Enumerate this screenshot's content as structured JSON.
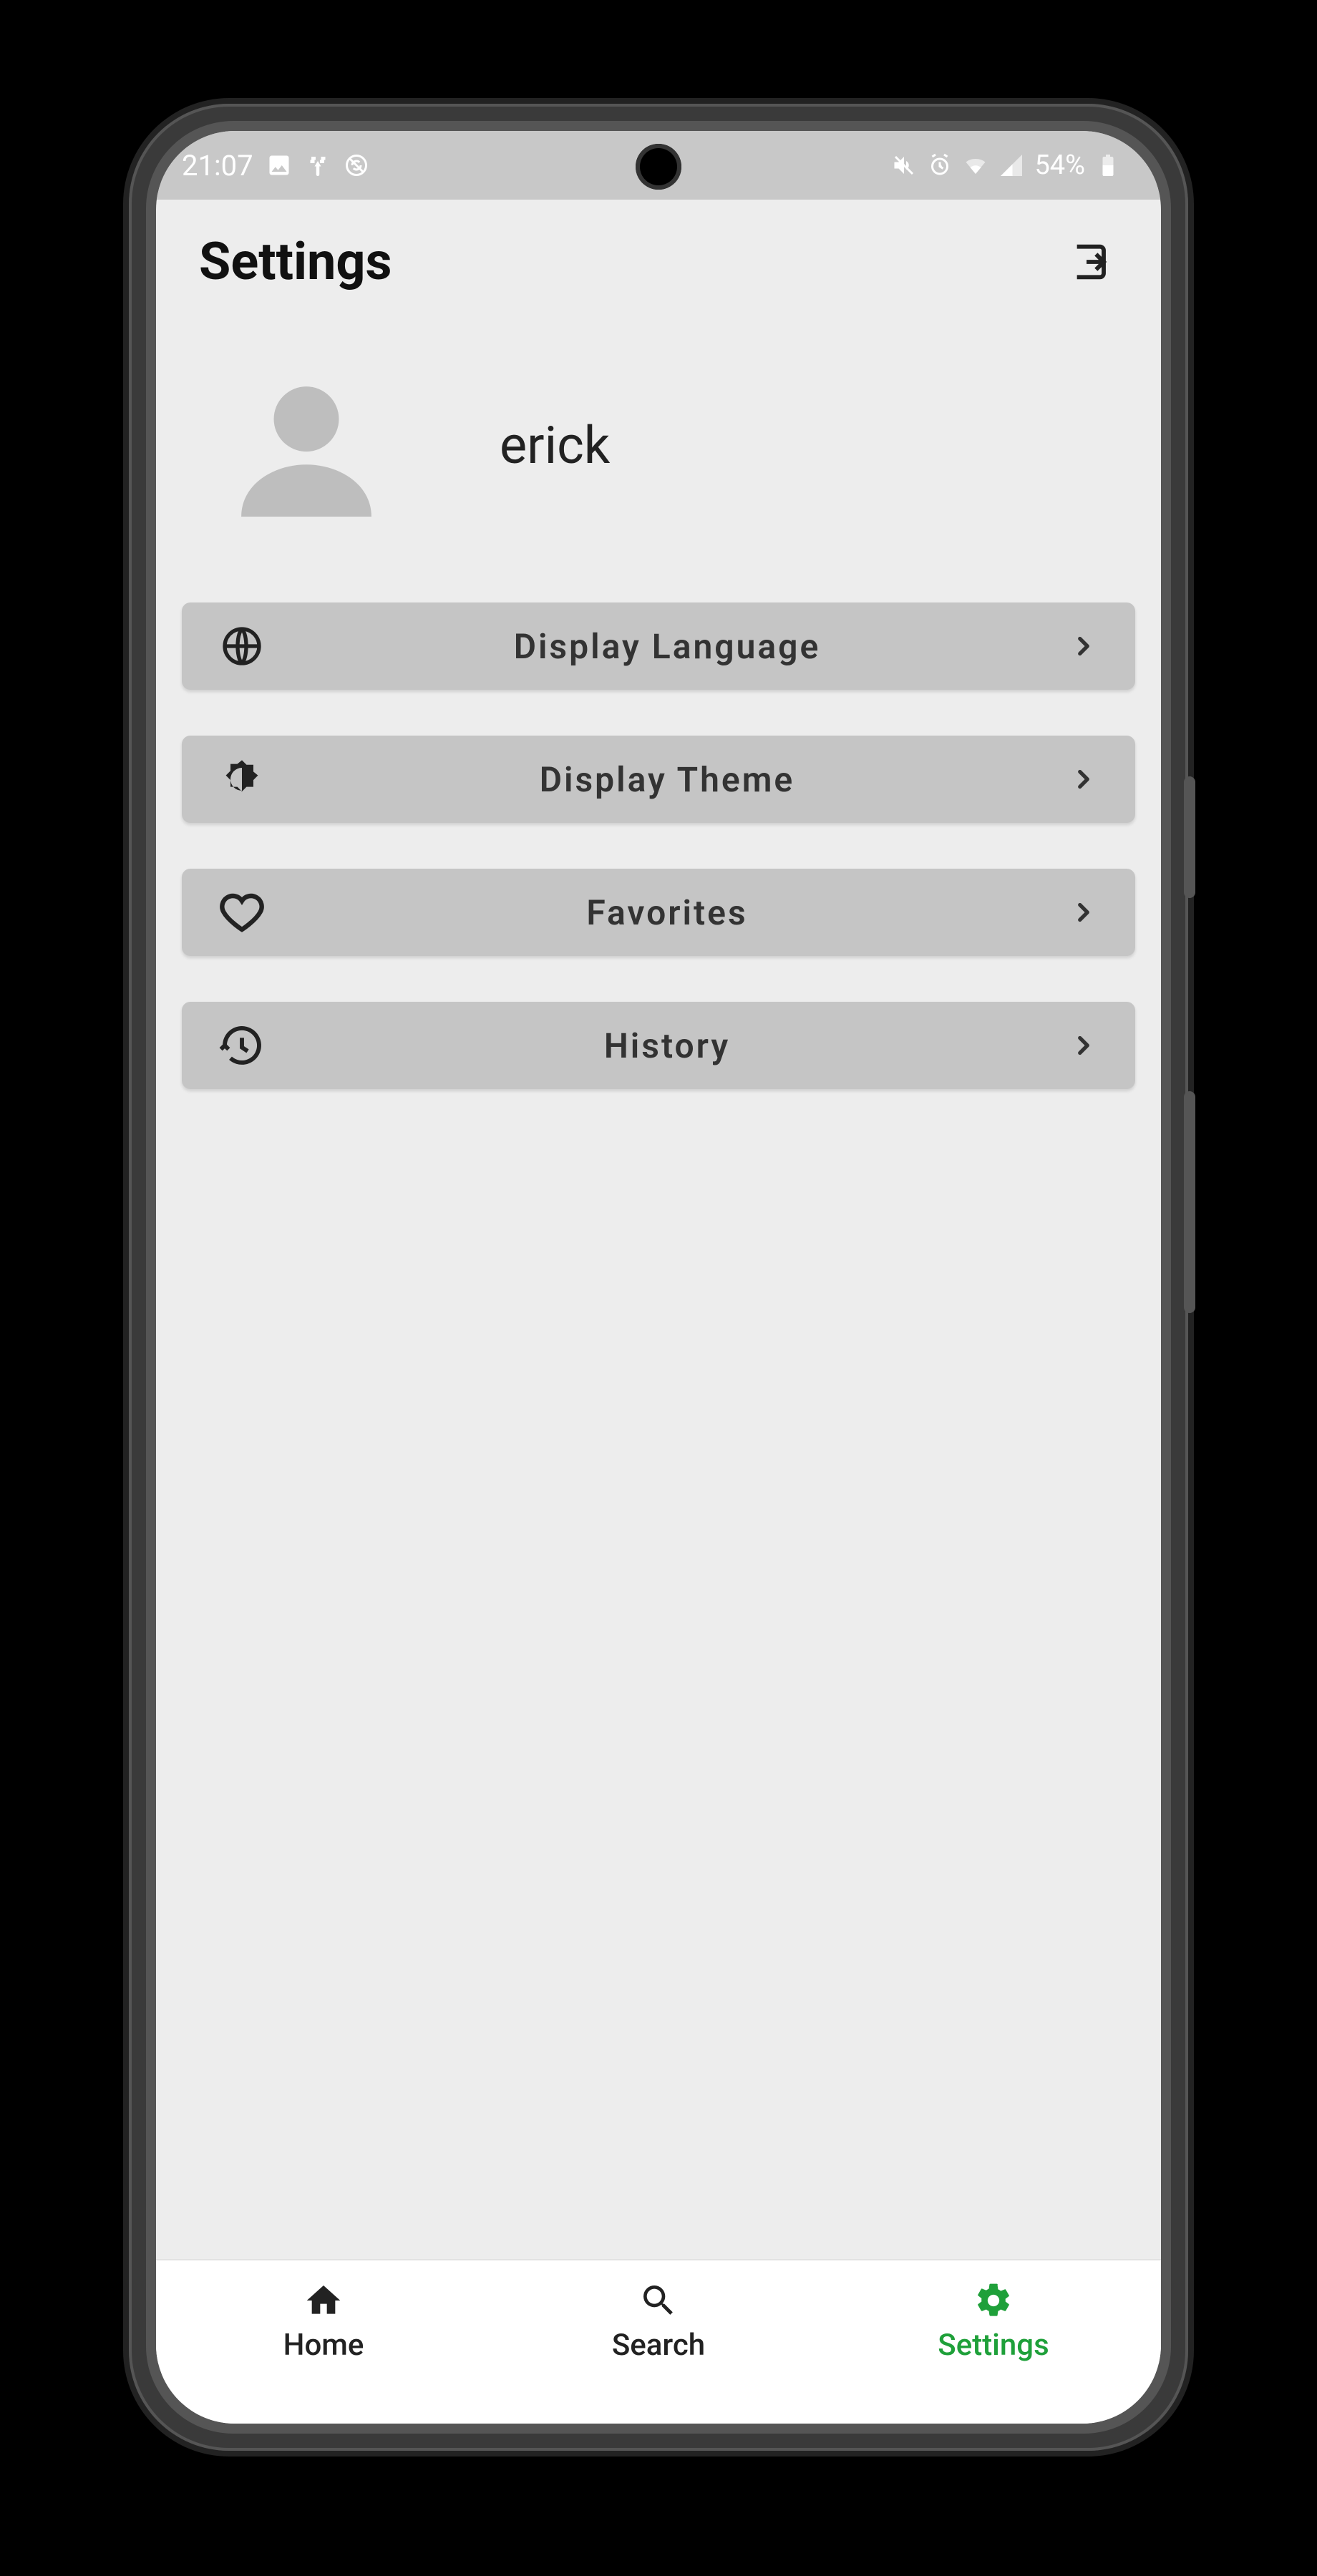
{
  "status": {
    "time": "21:07",
    "battery_text": "54%"
  },
  "header": {
    "title": "Settings"
  },
  "profile": {
    "name": "erick"
  },
  "settings": [
    {
      "icon": "globe-icon",
      "label": "Display Language"
    },
    {
      "icon": "brightness-icon",
      "label": "Display Theme"
    },
    {
      "icon": "heart-icon",
      "label": "Favorites"
    },
    {
      "icon": "history-icon",
      "label": "History"
    }
  ],
  "nav": {
    "home": "Home",
    "search": "Search",
    "settings": "Settings",
    "active": "settings"
  },
  "colors": {
    "accent": "#1fa03a",
    "row_bg": "#C5C5C5",
    "screen_bg": "#EDEDED",
    "status_bg": "#C8C8C8"
  }
}
